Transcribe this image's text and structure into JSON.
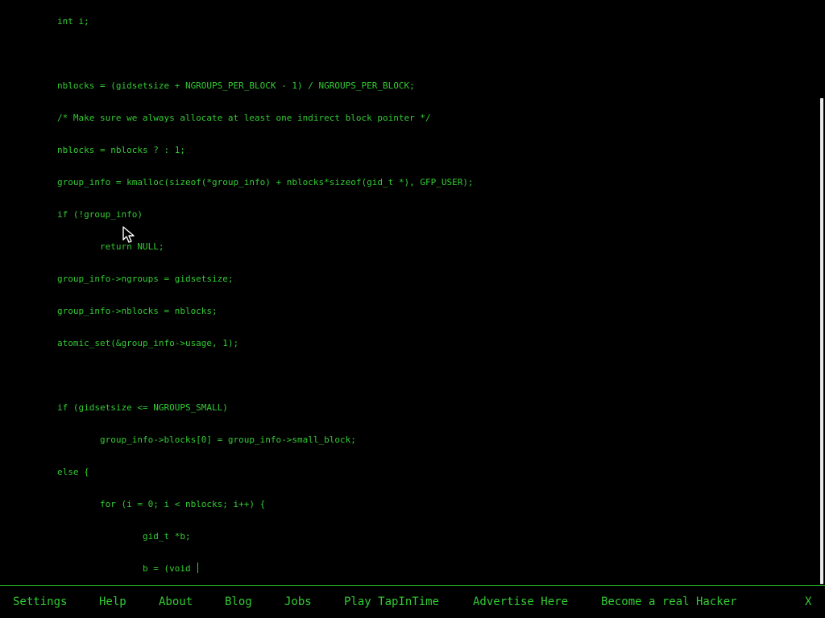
{
  "editor": {
    "lines": [
      "int i;",
      "",
      "nblocks = (gidsetsize + NGROUPS_PER_BLOCK - 1) / NGROUPS_PER_BLOCK;",
      "/* Make sure we always allocate at least one indirect block pointer */",
      "nblocks = nblocks ? : 1;",
      "group_info = kmalloc(sizeof(*group_info) + nblocks*sizeof(gid_t *), GFP_USER);",
      "if (!group_info)",
      "        return NULL;",
      "group_info->ngroups = gidsetsize;",
      "group_info->nblocks = nblocks;",
      "atomic_set(&group_info->usage, 1);",
      "",
      "if (gidsetsize <= NGROUPS_SMALL)",
      "        group_info->blocks[0] = group_info->small_block;",
      "else {",
      "        for (i = 0; i < nblocks; i++) {",
      "                gid_t *b;",
      "                b = (void "
    ]
  },
  "footer": {
    "links": [
      "Settings",
      "Help",
      "About",
      "Blog",
      "Jobs",
      "Play TapInTime",
      "Advertise Here",
      "Become a real Hacker"
    ],
    "close_label": "X"
  },
  "colors": {
    "background": "#000000",
    "text": "#33cc33",
    "footer_border": "#22aa22"
  }
}
